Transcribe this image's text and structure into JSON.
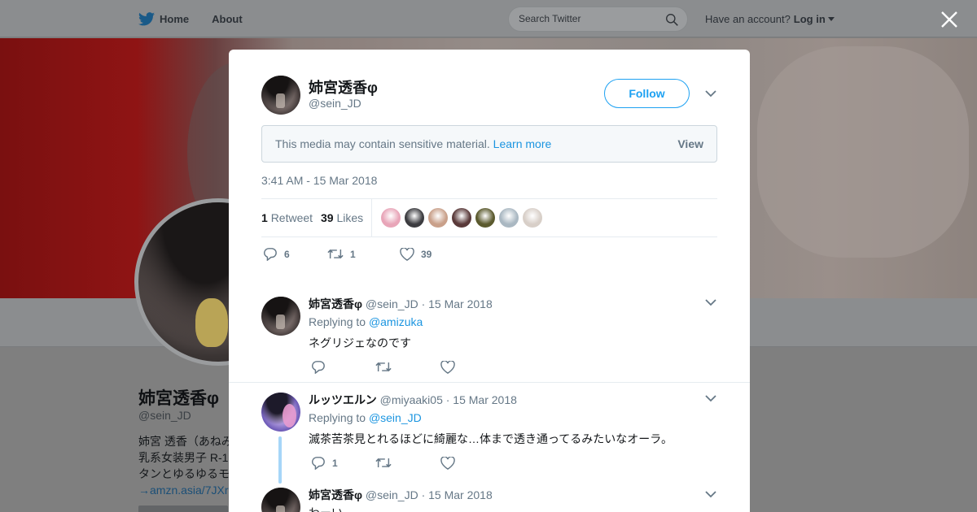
{
  "nav": {
    "home_label": "Home",
    "about_label": "About",
    "search_placeholder": "Search Twitter",
    "account_prompt": "Have an account?",
    "login_label": "Log in"
  },
  "background_profile": {
    "name": "姉宮透香φ",
    "handle": "@sein_JD",
    "bio_lines": [
      "姉宮 透香（あねみ",
      "乳系女装男子 R-1",
      "タンとゆるゆるモ"
    ],
    "bio_link": "→amzn.asia/7JXr"
  },
  "main_tweet": {
    "name": "姉宮透香φ",
    "handle": "@sein_JD",
    "follow_label": "Follow",
    "sensitive_message": "This media may contain sensitive material.",
    "learn_more_label": "Learn more",
    "view_label": "View",
    "timestamp": "3:41 AM - 15 Mar 2018",
    "retweet_count": "1",
    "retweet_label": "Retweet",
    "like_count": "39",
    "like_label": "Likes",
    "likers": [
      {
        "color": "#e8a5b8"
      },
      {
        "color": "#3c3c40"
      },
      {
        "color": "#c9a08a"
      },
      {
        "color": "#5a3a3a"
      },
      {
        "color": "#5b5a2e"
      },
      {
        "color": "#aab8c2"
      },
      {
        "color": "#d8cfc8"
      }
    ],
    "actions": {
      "reply_count": "6",
      "retweet_count": "1",
      "like_count": "39"
    }
  },
  "replies": [
    {
      "name": "姉宮透香φ",
      "meta": "@sein_JD · 15 Mar 2018",
      "replying_prefix": "Replying to",
      "replying_to": "@amizuka",
      "text": "ネグリジェなのです",
      "reply_count": "",
      "retweet_count": "",
      "like_count": ""
    },
    {
      "name": "ルッツエルン",
      "meta": "@miyaaki05 · 15 Mar 2018",
      "replying_prefix": "Replying to",
      "replying_to": "@sein_JD",
      "text": "滅茶苦茶見とれるほどに綺麗な…体まで透き通ってるみたいなオーラ。",
      "reply_count": "1",
      "retweet_count": "",
      "like_count": ""
    },
    {
      "name": "姉宮透香φ",
      "meta": "@sein_JD · 15 Mar 2018",
      "text": "わーい"
    }
  ],
  "colors": {
    "accent": "#1da1f2",
    "link": "#1b95e0",
    "muted": "#657786",
    "thread": "#a6d6f8"
  }
}
